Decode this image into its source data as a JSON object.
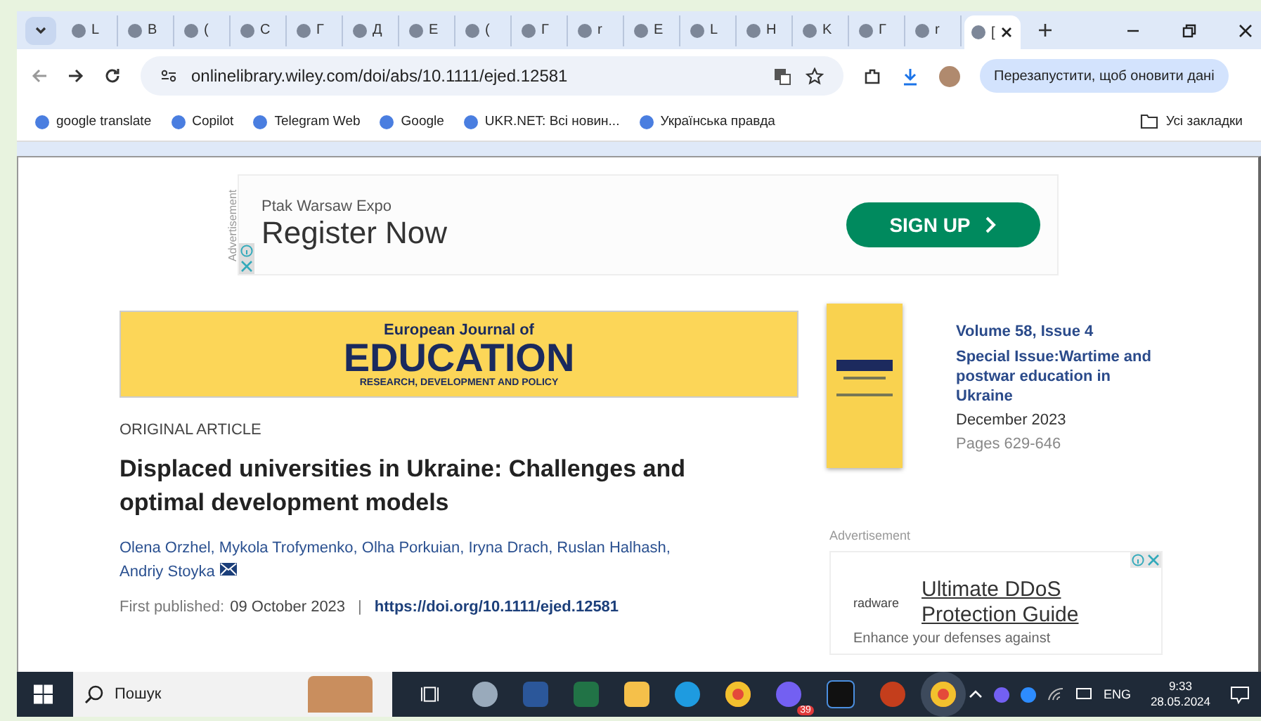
{
  "tabs": [
    {
      "label": "L",
      "selected": false
    },
    {
      "label": "B",
      "selected": false
    },
    {
      "label": "(",
      "selected": false
    },
    {
      "label": "C",
      "selected": false
    },
    {
      "label": "Г",
      "selected": false
    },
    {
      "label": "Д",
      "selected": false
    },
    {
      "label": "E",
      "selected": false
    },
    {
      "label": "(",
      "selected": false
    },
    {
      "label": "Г",
      "selected": false
    },
    {
      "label": "r",
      "selected": false
    },
    {
      "label": "E",
      "selected": false
    },
    {
      "label": "L",
      "selected": false
    },
    {
      "label": "H",
      "selected": false
    },
    {
      "label": "K",
      "selected": false
    },
    {
      "label": "Г",
      "selected": false
    },
    {
      "label": "r",
      "selected": false
    },
    {
      "label": "[",
      "selected": true
    }
  ],
  "address_bar": {
    "url": "onlinelibrary.wiley.com/doi/abs/10.1111/ejed.12581"
  },
  "update_button": "Перезапустити, щоб оновити дані",
  "bookmarks": [
    "google translate",
    "Copilot",
    "Telegram Web",
    "Google",
    "UKR.NET: Всі новин...",
    "Українська правда"
  ],
  "all_bookmarks": "Усі закладки",
  "top_ad": {
    "side_label": "Advertisement",
    "sponsor": "Ptak Warsaw Expo",
    "headline": "Register Now",
    "button": "SIGN UP"
  },
  "journal_banner": {
    "line1": "European Journal of",
    "line2": "EDUCATION",
    "line3": "RESEARCH, DEVELOPMENT AND POLICY"
  },
  "article": {
    "type": "ORIGINAL ARTICLE",
    "title": "Displaced universities in Ukraine: Challenges and optimal development models",
    "authors": "Olena Orzhel, Mykola Trofymenko, Olha Porkuian, Iryna Drach, Ruslan Halhash, Andriy Stoyka",
    "published_label": "First published:",
    "published_date": "09 October 2023",
    "separator": "|",
    "doi": "https://doi.org/10.1111/ejed.12581"
  },
  "issue": {
    "volume": "Volume 58, Issue 4",
    "special": "Special Issue:Wartime and postwar education in Ukraine",
    "date": "December 2023",
    "pages": "Pages 629-646"
  },
  "side_ad": {
    "label": "Advertisement",
    "brand": "radware",
    "headline": "Ultimate DDoS Protection Guide",
    "body": "Enhance your defenses against"
  },
  "taskbar": {
    "search": "Пошук",
    "viber_badge": "39",
    "language": "ENG",
    "time": "9:33",
    "date": "28.05.2024"
  }
}
